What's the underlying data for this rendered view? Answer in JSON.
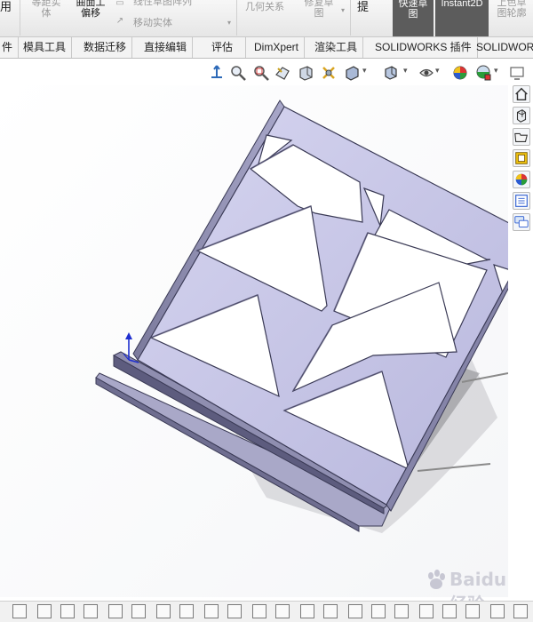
{
  "ribbon": {
    "left_label": "用",
    "equal_distance_label_1": "等距实",
    "equal_distance_label_2": "体",
    "surface_offset_label_1": "曲面工",
    "surface_offset_label_2": "偏移",
    "linear_pattern_label": "线性草图阵列",
    "move_entities_label": "移动实体",
    "relations_label": "几何关系",
    "repair_sketch_label_1": "修复草",
    "repair_sketch_label_2": "图",
    "exit_label": "提",
    "quick_sketch_label_1": "快速草",
    "quick_sketch_label_2": "图",
    "instant2d_label": "Instant2D",
    "shaded_sketch_label_1": "上色草",
    "shaded_sketch_label_2": "图轮廓"
  },
  "tabs": [
    {
      "label": "件"
    },
    {
      "label": "模具工具"
    },
    {
      "label": "数据迁移"
    },
    {
      "label": "直接编辑"
    },
    {
      "label": "评估"
    },
    {
      "label": "DimXpert"
    },
    {
      "label": "渲染工具"
    },
    {
      "label": "SOLIDWORKS 插件"
    },
    {
      "label": "SOLIDWORK"
    }
  ],
  "watermark": {
    "text": "Baidu 经验"
  },
  "colors": {
    "part_face": "#c9c8e8",
    "part_edge": "#3a3a55",
    "triad_arrow": "#1f2fcf"
  }
}
